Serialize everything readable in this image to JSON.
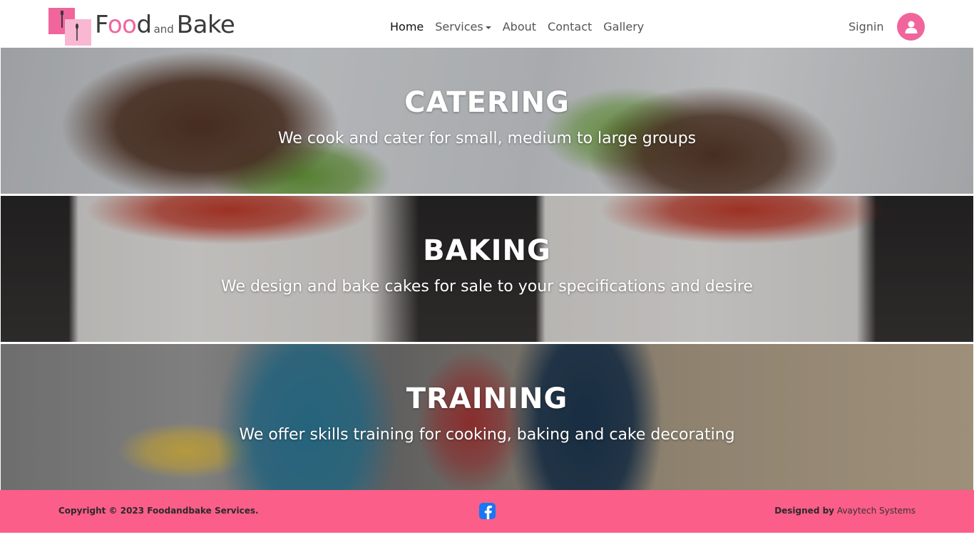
{
  "brand": {
    "word1_start": "F",
    "word1_oo": "oo",
    "word1_end": "d",
    "word_and": "and",
    "word2": "Bake",
    "colors": {
      "pink": "#f0659b",
      "light_pink": "#f9b7d1",
      "footer_pink": "#fb5e88"
    },
    "icon": "fork-spoon-icon"
  },
  "nav": {
    "items": [
      {
        "label": "Home",
        "active": true
      },
      {
        "label": "Services",
        "dropdown": true
      },
      {
        "label": "About"
      },
      {
        "label": "Contact"
      },
      {
        "label": "Gallery"
      }
    ],
    "signin_label": "Signin",
    "user_icon": "user-icon"
  },
  "banners": [
    {
      "title": "CATERING",
      "subtitle": "We cook and cater for small, medium to large groups"
    },
    {
      "title": "BAKING",
      "subtitle": "We design and bake cakes for sale to your specifications and desire"
    },
    {
      "title": "TRAINING",
      "subtitle": "We offer skills training for cooking, baking and cake decorating"
    }
  ],
  "footer": {
    "copyright": "Copyright © 2023 Foodandbake Services.",
    "social_icon": "facebook-icon",
    "designed_prefix": "Designed by",
    "designer": "Avaytech Systems"
  }
}
